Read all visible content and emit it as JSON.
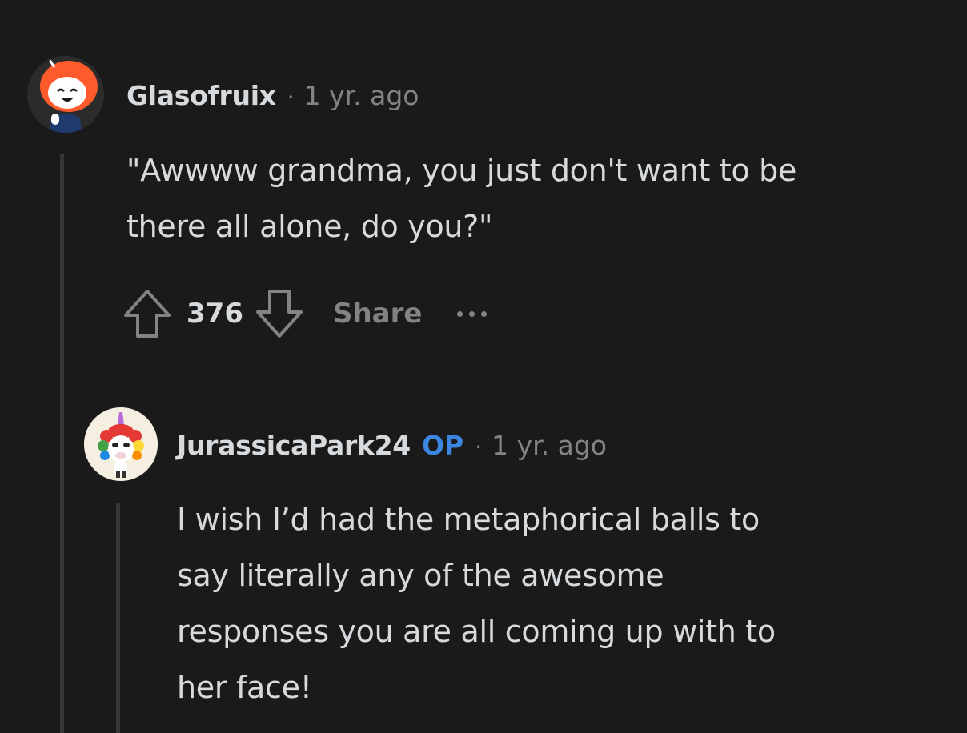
{
  "comments": [
    {
      "username": "Glasofruix",
      "separator": "·",
      "time": "1 yr. ago",
      "body_lines": [
        "\"Awwww grandma, you just don't want to be",
        "there all alone, do you?\""
      ],
      "score": "376",
      "share_label": "Share",
      "avatar_icon": "snoo-orange-hood-avatar"
    },
    {
      "username": "JurassicaPark24",
      "badge": "OP",
      "separator": "·",
      "time": "1 yr. ago",
      "body_lines": [
        "I wish I’d had the metaphorical balls to",
        "say literally any of the awesome",
        "responses you are all coming up with to",
        "her face!"
      ],
      "avatar_icon": "rainbow-unicorn-avatar"
    }
  ],
  "colors": {
    "background": "#1a1a1b",
    "text": "#d7dadc",
    "muted": "#818384",
    "thread_line": "#343536",
    "op_badge": "#3a86e0"
  },
  "icons": {
    "upvote": "upvote-arrow-icon",
    "downvote": "downvote-arrow-icon",
    "more": "more-options-icon"
  }
}
